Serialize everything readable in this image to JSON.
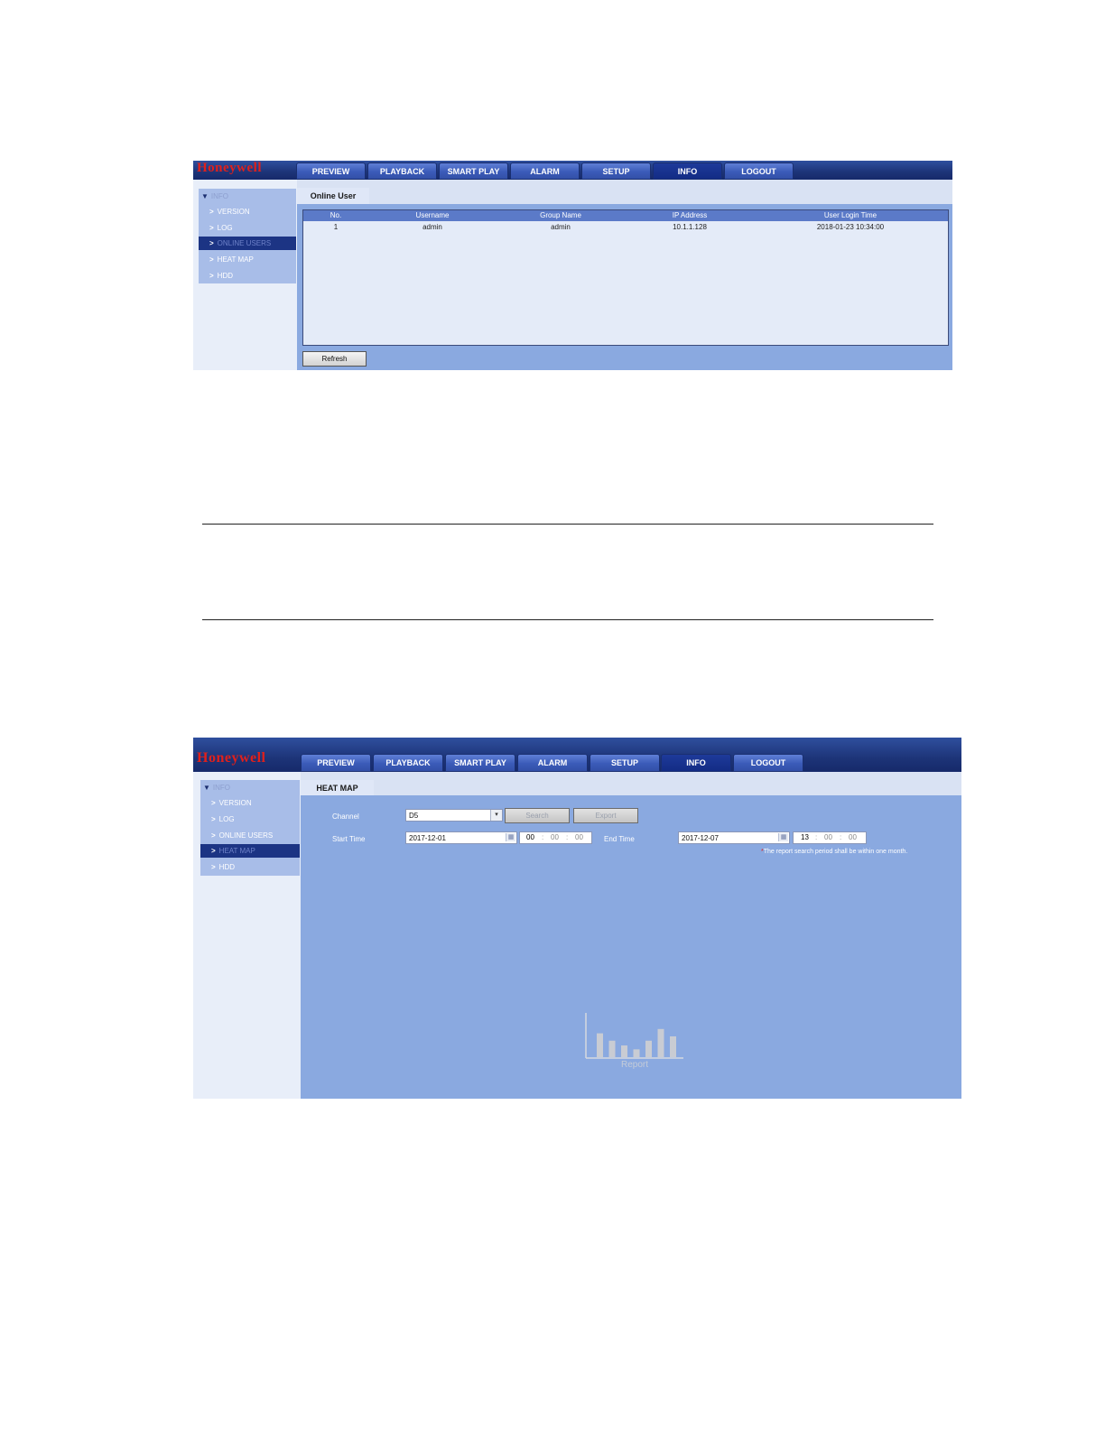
{
  "screenshot1": {
    "logo": "Honeywell",
    "nav_tabs": [
      "PREVIEW",
      "PLAYBACK",
      "SMART PLAY",
      "ALARM",
      "SETUP",
      "INFO",
      "LOGOUT"
    ],
    "active_tab": "INFO",
    "sidebar": {
      "header": "INFO",
      "items": [
        "VERSION",
        "LOG",
        "ONLINE USERS",
        "HEAT MAP",
        "HDD"
      ],
      "selected": "ONLINE USERS"
    },
    "content_tab": "Online User",
    "table": {
      "columns": [
        "No.",
        "Username",
        "Group Name",
        "IP Address",
        "User Login Time"
      ],
      "rows": [
        [
          "1",
          "admin",
          "admin",
          "10.1.1.128",
          "2018-01-23 10:34:00"
        ]
      ]
    },
    "refresh_button": "Refresh"
  },
  "screenshot2": {
    "logo": "Honeywell",
    "nav_tabs": [
      "PREVIEW",
      "PLAYBACK",
      "SMART PLAY",
      "ALARM",
      "SETUP",
      "INFO",
      "LOGOUT"
    ],
    "active_tab": "INFO",
    "sidebar": {
      "header": "INFO",
      "items": [
        "VERSION",
        "LOG",
        "ONLINE USERS",
        "HEAT MAP",
        "HDD"
      ],
      "selected": "HEAT MAP"
    },
    "content_tab": "HEAT MAP",
    "form": {
      "channel_label": "Channel",
      "channel_value": "D5",
      "search_button": "Search",
      "export_button": "Export",
      "start_time_label": "Start Time",
      "start_date": "2017-12-01",
      "start_hour": "00",
      "start_minute": "00",
      "start_second": "00",
      "end_time_label": "End Time",
      "end_date": "2017-12-07",
      "end_hour": "13",
      "end_minute": "00",
      "end_second": "00",
      "note": "The report search period shall be within one month."
    },
    "placeholder_caption": "Report",
    "placeholder_bars": [
      0.55,
      0.38,
      0.27,
      0.18,
      0.38,
      0.65,
      0.48
    ]
  }
}
